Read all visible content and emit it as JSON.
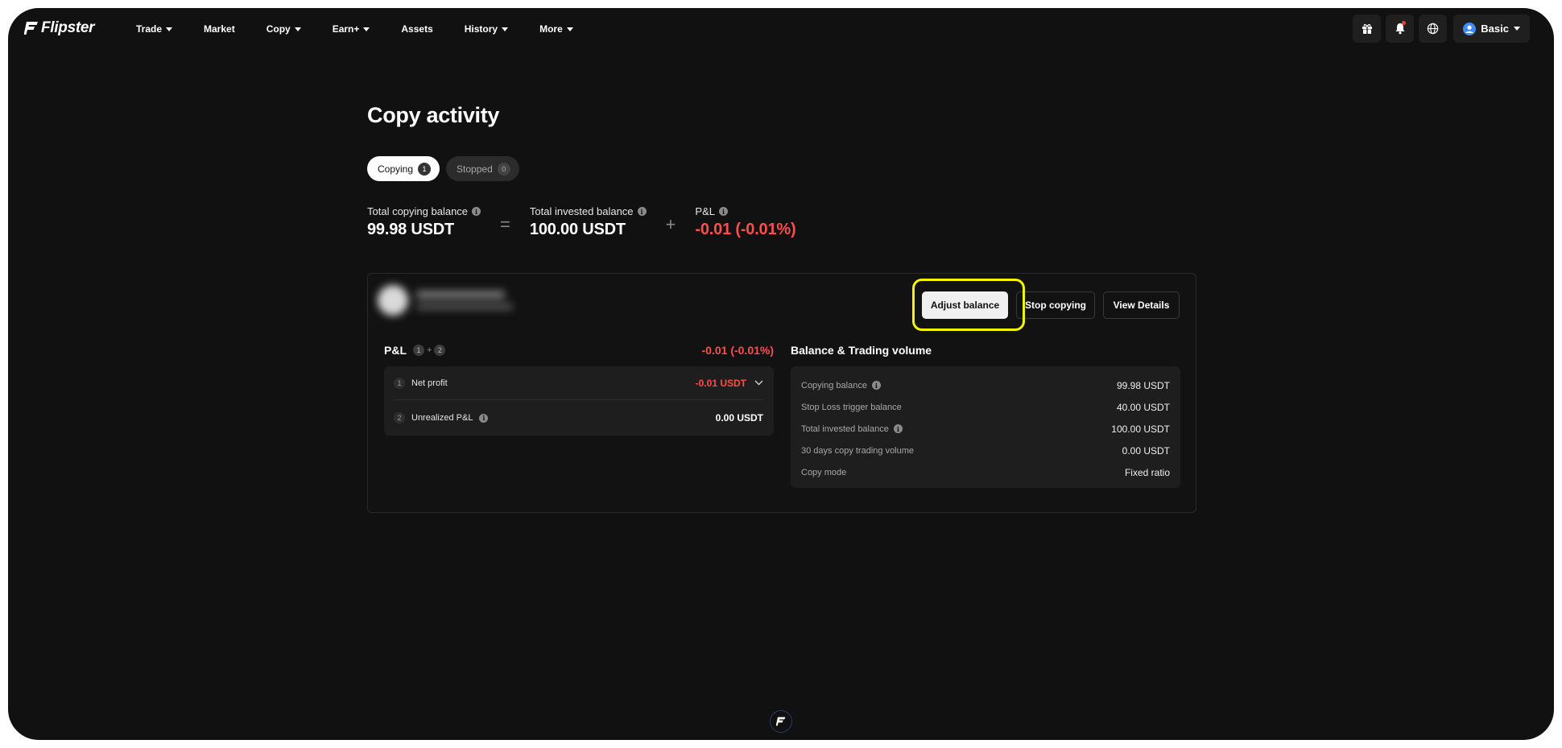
{
  "brand": {
    "name": "Flipster"
  },
  "nav": {
    "items": [
      {
        "label": "Trade",
        "has_caret": true
      },
      {
        "label": "Market",
        "has_caret": false
      },
      {
        "label": "Copy",
        "has_caret": true
      },
      {
        "label": "Earn+",
        "has_caret": true
      },
      {
        "label": "Assets",
        "has_caret": false
      },
      {
        "label": "History",
        "has_caret": true
      },
      {
        "label": "More",
        "has_caret": true
      }
    ],
    "right_icons": [
      "gift-icon",
      "bell-icon",
      "globe-icon"
    ],
    "account_label": "Basic"
  },
  "page": {
    "title": "Copy activity"
  },
  "tabs": [
    {
      "label": "Copying",
      "count": "1",
      "active": true
    },
    {
      "label": "Stopped",
      "count": "0",
      "active": false
    }
  ],
  "summary": {
    "copying_balance": {
      "label": "Total copying balance",
      "value": "99.98 USDT"
    },
    "op1": "=",
    "invested_balance": {
      "label": "Total invested balance",
      "value": "100.00 USDT"
    },
    "op2": "+",
    "pnl": {
      "label": "P&L",
      "value": "-0.01 (-0.01%)"
    }
  },
  "card": {
    "actions": {
      "adjust": "Adjust balance",
      "stop": "Stop copying",
      "details": "View Details"
    },
    "pnl": {
      "title": "P&L",
      "badge1": "1",
      "plus": "+",
      "badge2": "2",
      "total": "-0.01 (-0.01%)",
      "rows": [
        {
          "num": "1",
          "label": "Net profit",
          "value": "-0.01 USDT"
        },
        {
          "num": "2",
          "label": "Unrealized P&L",
          "value": "0.00 USDT"
        }
      ]
    },
    "balance": {
      "title": "Balance & Trading volume",
      "rows": [
        {
          "label": "Copying balance",
          "value": "99.98 USDT"
        },
        {
          "label": "Stop Loss trigger balance",
          "value": "40.00 USDT"
        },
        {
          "label": "Total invested balance",
          "value": "100.00 USDT"
        },
        {
          "label": "30 days copy trading volume",
          "value": "0.00 USDT"
        },
        {
          "label": "Copy mode",
          "value": "Fixed ratio"
        }
      ]
    }
  },
  "colors": {
    "background": "#111111",
    "negative": "#ff4d4d",
    "highlight": "#f5f500",
    "account_icon": "#3d8bff"
  }
}
